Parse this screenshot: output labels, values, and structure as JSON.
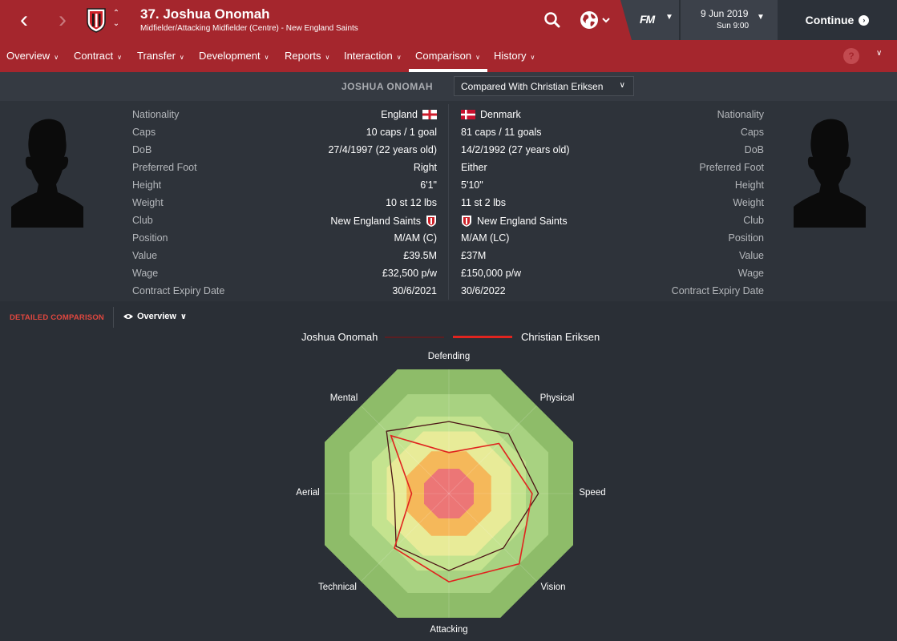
{
  "header": {
    "title": "37. Joshua Onomah",
    "subtitle": "Midfielder/Attacking Midfielder (Centre) - New England Saints",
    "date": "9 Jun 2019",
    "time": "Sun 9:00",
    "fm_logo": "FM",
    "continue_label": "Continue"
  },
  "tabs": [
    {
      "label": "Overview"
    },
    {
      "label": "Contract"
    },
    {
      "label": "Transfer"
    },
    {
      "label": "Development"
    },
    {
      "label": "Reports"
    },
    {
      "label": "Interaction"
    },
    {
      "label": "Comparison",
      "active": true
    },
    {
      "label": "History"
    }
  ],
  "help_label": "?",
  "comparison": {
    "player_name": "JOSHUA ONOMAH",
    "compared_with": "Compared With Christian Eriksen"
  },
  "rows": [
    {
      "label": "Nationality",
      "left": "England",
      "right": "Denmark"
    },
    {
      "label": "Caps",
      "left": "10 caps / 1 goal",
      "right": "81 caps / 11 goals"
    },
    {
      "label": "DoB",
      "left": "27/4/1997 (22 years old)",
      "right": "14/2/1992 (27 years old)"
    },
    {
      "label": "Preferred Foot",
      "left": "Right",
      "right": "Either"
    },
    {
      "label": "Height",
      "left": "6'1\"",
      "right": "5'10\""
    },
    {
      "label": "Weight",
      "left": "10 st 12 lbs",
      "right": "11 st 2 lbs"
    },
    {
      "label": "Club",
      "left": "New England Saints",
      "right": "New England Saints"
    },
    {
      "label": "Position",
      "left": "M/AM (C)",
      "right": "M/AM (LC)"
    },
    {
      "label": "Value",
      "left": "£39.5M",
      "right": "£37M"
    },
    {
      "label": "Wage",
      "left": "£32,500 p/w",
      "right": "£150,000 p/w"
    },
    {
      "label": "Contract Expiry Date",
      "left": "30/6/2021",
      "right": "30/6/2022"
    }
  ],
  "detail": {
    "section_label": "DETAILED COMPARISON",
    "view": "Overview"
  },
  "chart_data": {
    "type": "radar",
    "axes": [
      "Defending",
      "Physical",
      "Speed",
      "Vision",
      "Attacking",
      "Technical",
      "Aerial",
      "Mental"
    ],
    "rmax": 1.0,
    "series": [
      {
        "name": "Joshua Onomah",
        "color": "#4a1214",
        "values": [
          0.58,
          0.68,
          0.72,
          0.62,
          0.62,
          0.6,
          0.44,
          0.71
        ]
      },
      {
        "name": "Christian Eriksen",
        "color": "#e0241f",
        "values": [
          0.33,
          0.57,
          0.67,
          0.8,
          0.71,
          0.62,
          0.3,
          0.66
        ]
      }
    ],
    "band_colors": [
      "#8ebc69",
      "#a8d281",
      "#c4e38f",
      "#e8eb98",
      "#f5b85a",
      "#ec7676"
    ]
  },
  "colors": {
    "header_red": "#a5262d",
    "accent_red": "#e0473f",
    "background": "#2a2f36"
  }
}
